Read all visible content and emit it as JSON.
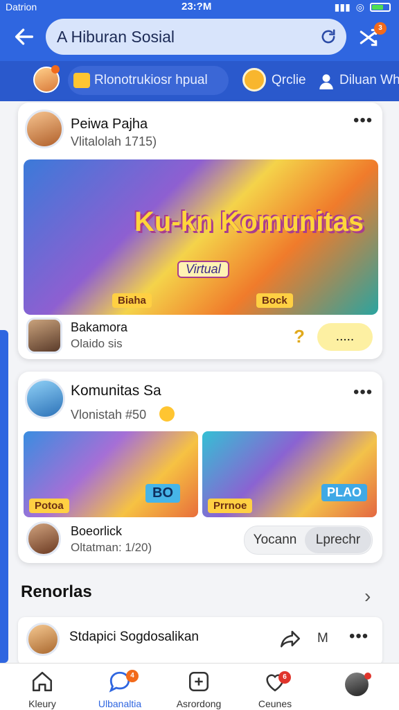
{
  "status_bar": {
    "carrier": "Datrion",
    "time": "23:?M"
  },
  "header": {
    "search_text": "A Hiburan Sosial",
    "notification_count": "3"
  },
  "tabs": {
    "chip_label": "Rlonotrukiosr hpual",
    "tab2_label": "Qrclie",
    "tab3_label": "Diluan Wh"
  },
  "post1": {
    "author": "Peiwa Pajha",
    "meta": "Vlitalolah 1715)",
    "banner_title": "Ku-kn Komunitas",
    "banner_subtitle": "Virtual",
    "banner_tag_left": "Biaha",
    "banner_tag_right": "Bock",
    "comment_author": "Bakamora",
    "comment_sub": "Olaido sis",
    "reply_placeholder": "....."
  },
  "post2": {
    "author": "Komunitas Sa",
    "meta": "Vlonistah #50",
    "img1_tag": "Potoa",
    "img1_sign": "BO",
    "img2_tag": "Prrnoe",
    "img2_sign": "PLAO",
    "comment_author": "Boeorlick",
    "comment_sub": "Oltatman: 1/20)",
    "btn_left": "Yocann",
    "btn_right": "Lprechr"
  },
  "section": {
    "title": "Renorlas",
    "row_title": "Stdapici Sogdosalikan",
    "row_letter": "M"
  },
  "bottom_nav": [
    {
      "label": "Kleury"
    },
    {
      "label": "Ulbanaltia",
      "badge": "4"
    },
    {
      "label": "Asrordong"
    },
    {
      "label": "Ceunes",
      "badge": "6"
    },
    {
      "label": ""
    }
  ],
  "colors": {
    "brand": "#2f66e0",
    "accent": "#f26a1b",
    "highlight": "#ffd043"
  }
}
